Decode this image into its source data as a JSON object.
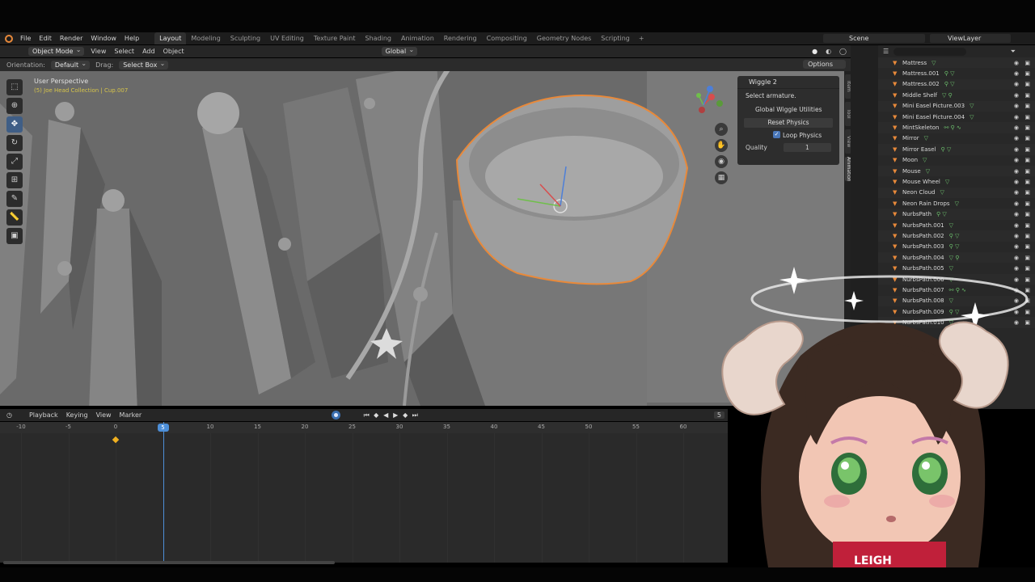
{
  "menubar": {
    "menus": [
      "File",
      "Edit",
      "Render",
      "Window",
      "Help"
    ],
    "workspaces": [
      "Layout",
      "Modeling",
      "Sculpting",
      "UV Editing",
      "Texture Paint",
      "Shading",
      "Animation",
      "Rendering",
      "Compositing",
      "Geometry Nodes",
      "Scripting"
    ],
    "active_workspace": "Layout",
    "scene": "Scene",
    "view_layer": "ViewLayer"
  },
  "header": {
    "mode": "Object Mode",
    "menus": [
      "View",
      "Select",
      "Add",
      "Object"
    ],
    "transform_orientation": "Global"
  },
  "tool_settings": {
    "orientation_label": "Orientation:",
    "orientation_value": "Default",
    "drag_label": "Drag:",
    "drag_value": "Select Box",
    "options_label": "Options"
  },
  "viewport": {
    "view_name": "User Perspective",
    "object_info": "(5) Joe Head Collection | Cup.007"
  },
  "npanel": {
    "title": "Wiggle 2",
    "select_armature": "Select armature.",
    "section": "Global Wiggle Utilities",
    "reset_button": "Reset Physics",
    "loop_label": "Loop Physics",
    "quality_label": "Quality",
    "quality_value": "1",
    "tabs": [
      "Item",
      "Tool",
      "View",
      "Animation"
    ]
  },
  "outliner": {
    "items": [
      "Mattress",
      "Mattress.001",
      "Mattress.002",
      "Middle Shelf",
      "Mini Easel Picture.003",
      "Mini Easel Picture.004",
      "MintSkeleton",
      "Mirror",
      "Mirror Easel",
      "Moon",
      "Mouse",
      "Mouse Wheel",
      "Neon Cloud",
      "Neon Rain Drops",
      "NurbsPath",
      "NurbsPath.001",
      "NurbsPath.002",
      "NurbsPath.003",
      "NurbsPath.004",
      "NurbsPath.005",
      "NurbsPath.006",
      "NurbsPath.007",
      "NurbsPath.008",
      "NurbsPath.009",
      "NurbsPath.010"
    ]
  },
  "timeline": {
    "menus": [
      "Playback",
      "Keying",
      "View",
      "Marker"
    ],
    "ticks": [
      "-10",
      "-5",
      "0",
      "5",
      "10",
      "15",
      "20",
      "25",
      "30",
      "35",
      "40",
      "45",
      "50",
      "55",
      "60"
    ],
    "current_frame": "5",
    "current_frame_value": 5,
    "keyframe_frame": 0,
    "end_frame_display": "5"
  },
  "avatar": {
    "shirt_text": "LEIGH"
  },
  "colors": {
    "accent_blue": "#4d8fd8",
    "selection_orange": "#e8893a",
    "viewport_gray": "#6e6e6e"
  }
}
